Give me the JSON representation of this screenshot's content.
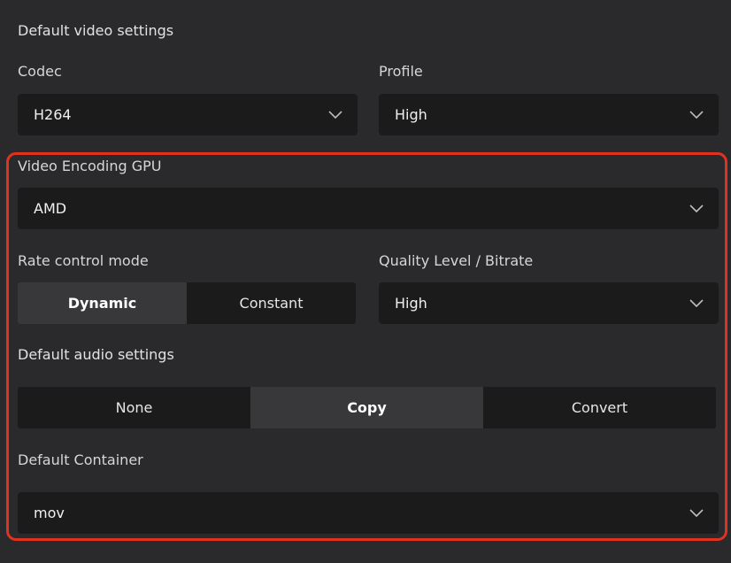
{
  "video": {
    "section_title": "Default video settings",
    "codec_label": "Codec",
    "codec_value": "H264",
    "profile_label": "Profile",
    "profile_value": "High",
    "gpu_label": "Video Encoding GPU",
    "gpu_value": "AMD",
    "rate_control_label": "Rate control mode",
    "rate_control_options": [
      "Dynamic",
      "Constant"
    ],
    "rate_control_selected": "Dynamic",
    "quality_label": "Quality Level / Bitrate",
    "quality_value": "High"
  },
  "audio": {
    "section_title": "Default audio settings",
    "options": [
      "None",
      "Copy",
      "Convert"
    ],
    "selected": "Copy"
  },
  "container": {
    "label": "Default Container",
    "value": "mov"
  },
  "icons": {
    "dropdown": "chevron-down-icon"
  },
  "colors": {
    "background": "#2a2a2d",
    "control_bg": "#1b1b1c",
    "segment_active": "#38383b",
    "highlight_border": "#e0321e"
  }
}
